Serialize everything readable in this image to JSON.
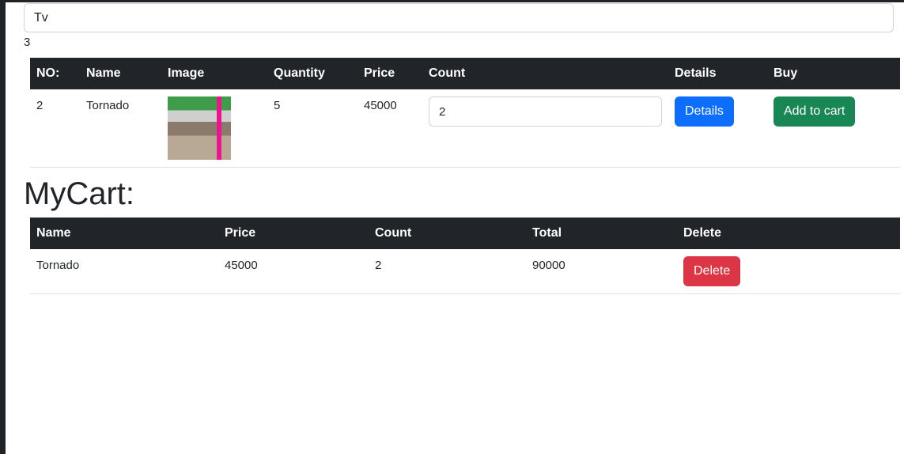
{
  "search": {
    "value": "Tv"
  },
  "result_count": "3",
  "products": {
    "headers": [
      "NO:",
      "Name",
      "Image",
      "Quantity",
      "Price",
      "Count",
      "Details",
      "Buy"
    ],
    "rows": [
      {
        "no": "2",
        "name": "Tornado",
        "quantity": "5",
        "price": "45000",
        "count": "2",
        "details_label": "Details",
        "buy_label": "Add to cart"
      }
    ]
  },
  "cart": {
    "title": "MyCart:",
    "headers": [
      "Name",
      "Price",
      "Count",
      "Total",
      "Delete"
    ],
    "rows": [
      {
        "name": "Tornado",
        "price": "45000",
        "count": "2",
        "total": "90000",
        "delete_label": "Delete"
      }
    ]
  },
  "colors": {
    "header_bg": "#212529",
    "primary": "#0d6efd",
    "success": "#198754",
    "danger": "#dc3545"
  }
}
